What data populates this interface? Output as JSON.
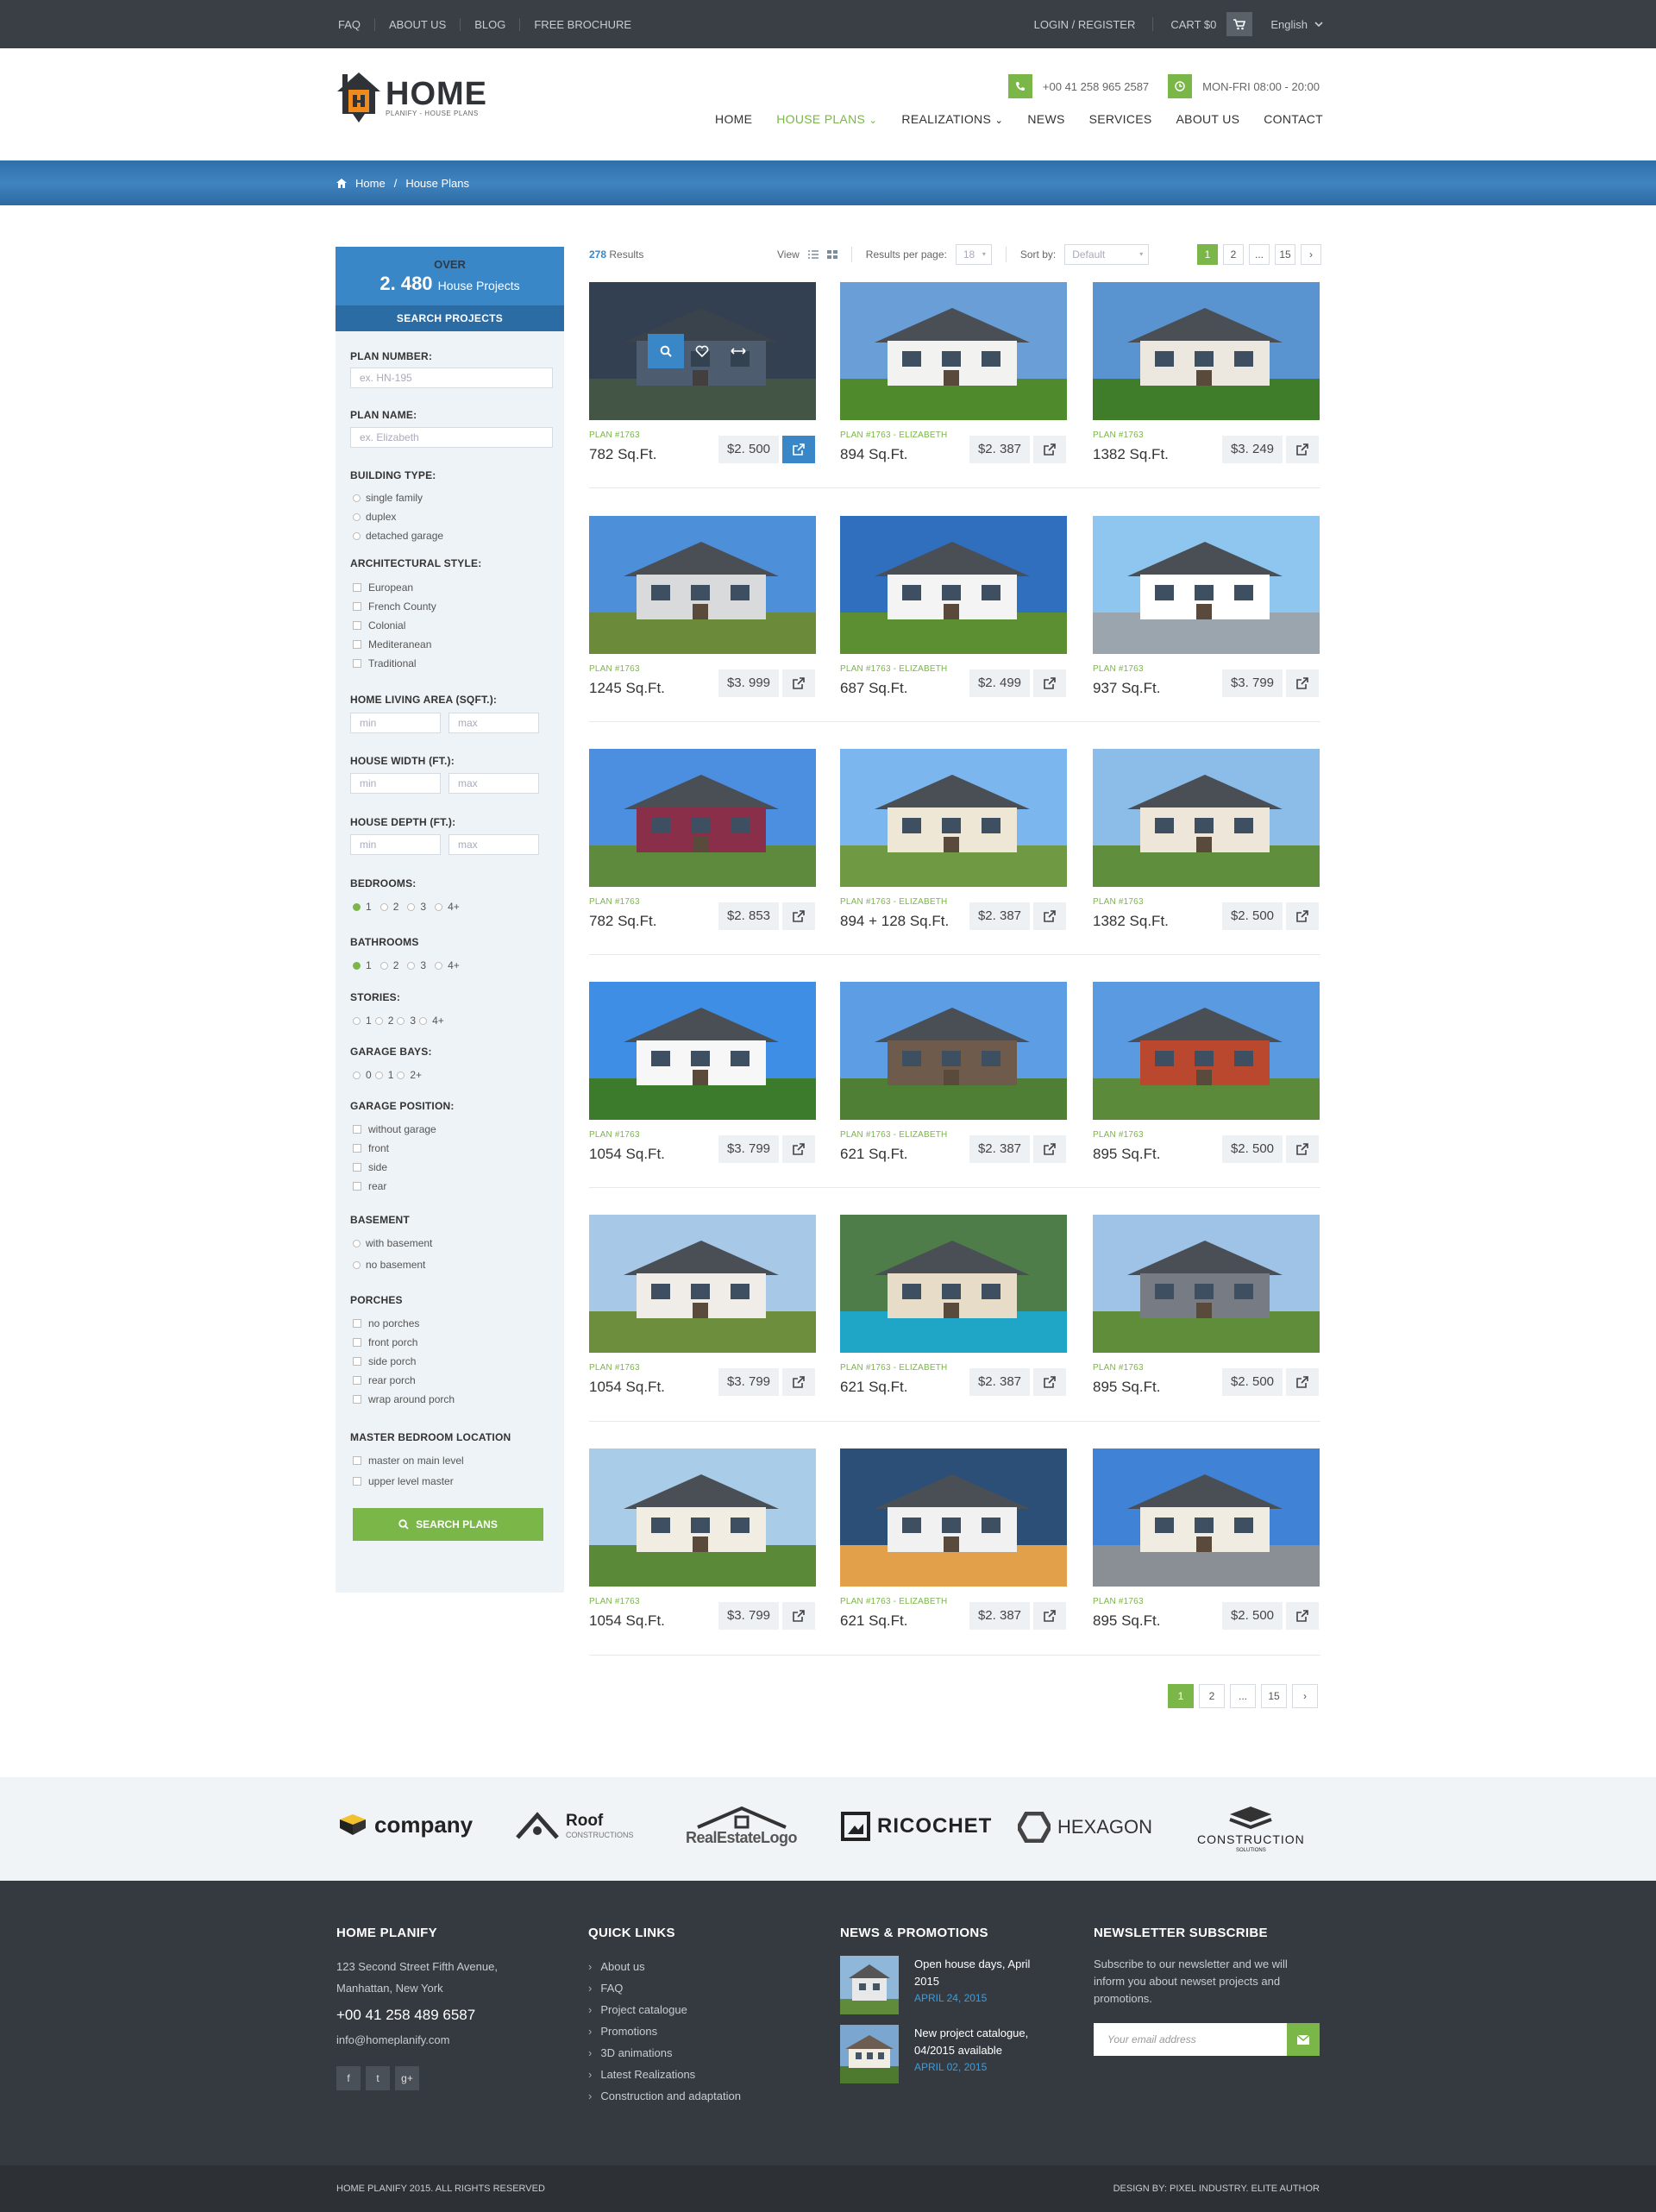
{
  "topbar": {
    "links": [
      "FAQ",
      "ABOUT US",
      "BLOG",
      "FREE BROCHURE"
    ],
    "login": "LOGIN / REGISTER",
    "cart": "CART $0",
    "language": "English"
  },
  "header": {
    "logo_title": "HOME",
    "logo_sub": "PLANIFY - HOUSE PLANS",
    "phone": "+00 41 258 965 2587",
    "hours": "MON-FRI 08:00 - 20:00",
    "nav": [
      "HOME",
      "HOUSE PLANS",
      "REALIZATIONS",
      "NEWS",
      "SERVICES",
      "ABOUT US",
      "CONTACT"
    ]
  },
  "breadcrumb": {
    "home": "Home",
    "sep": "/",
    "current": "House Plans"
  },
  "sidebar": {
    "over": "OVER",
    "count": "2. 480",
    "count_label": "House Projects",
    "search_projects": "SEARCH PROJECTS",
    "plan_number_label": "PLAN NUMBER:",
    "plan_number_ph": "ex. HN-195",
    "plan_name_label": "PLAN NAME:",
    "plan_name_ph": "ex. Elizabeth",
    "building_type_label": "BUILDING TYPE:",
    "building_types": [
      "single family",
      "duplex",
      "detached garage"
    ],
    "arch_style_label": "ARCHITECTURAL STYLE:",
    "arch_styles": [
      "European",
      "French County",
      "Colonial",
      "Mediteranean",
      "Traditional"
    ],
    "living_area_label": "HOME LIVING AREA (SQFT.):",
    "width_label": "HOUSE WIDTH (FT.):",
    "depth_label": "HOUSE DEPTH (FT.):",
    "min": "min",
    "max": "max",
    "bedrooms_label": "BEDROOMS:",
    "bathrooms_label": "BATHROOMS",
    "rooms": [
      "1",
      "2",
      "3",
      "4+"
    ],
    "stories_label": "STORIES:",
    "garage_bays_label": "GARAGE BAYS:",
    "garage_bays": [
      "0",
      "1",
      "2+"
    ],
    "garage_pos_label": "GARAGE POSITION:",
    "garage_pos": [
      "without garage",
      "front",
      "side",
      "rear"
    ],
    "basement_label": "BASEMENT",
    "basement": [
      "with basement",
      "no basement"
    ],
    "porches_label": "PORCHES",
    "porches": [
      "no porches",
      "front porch",
      "side porch",
      "rear porch",
      "wrap around porch"
    ],
    "master_label": "MASTER BEDROOM LOCATION",
    "master": [
      "master on main level",
      "upper level master"
    ],
    "search_plans": "SEARCH PLANS"
  },
  "results": {
    "count": "278",
    "count_label": "Results",
    "view": "View",
    "per_page_label": "Results per page:",
    "per_page": "18",
    "sort_label": "Sort by:",
    "sort": "Default",
    "pages": [
      "1",
      "2",
      "...",
      "15",
      "›"
    ]
  },
  "cards": [
    {
      "plan": "PLAN #1763",
      "sqft": "782 Sq.Ft.",
      "price": "$2. 500"
    },
    {
      "plan": "PLAN #1763 - ELIZABETH",
      "sqft": "894 Sq.Ft.",
      "price": "$2. 387"
    },
    {
      "plan": "PLAN #1763",
      "sqft": "1382 Sq.Ft.",
      "price": "$3. 249"
    },
    {
      "plan": "PLAN #1763",
      "sqft": "1245 Sq.Ft.",
      "price": "$3. 999"
    },
    {
      "plan": "PLAN #1763 - ELIZABETH",
      "sqft": "687 Sq.Ft.",
      "price": "$2. 499"
    },
    {
      "plan": "PLAN #1763",
      "sqft": "937 Sq.Ft.",
      "price": "$3. 799"
    },
    {
      "plan": "PLAN #1763",
      "sqft": "782 Sq.Ft.",
      "price": "$2. 853"
    },
    {
      "plan": "PLAN #1763 - ELIZABETH",
      "sqft": "894 + 128 Sq.Ft.",
      "price": "$2. 387"
    },
    {
      "plan": "PLAN #1763",
      "sqft": "1382 Sq.Ft.",
      "price": "$2. 500"
    },
    {
      "plan": "PLAN #1763",
      "sqft": "1054 Sq.Ft.",
      "price": "$3. 799"
    },
    {
      "plan": "PLAN #1763 - ELIZABETH",
      "sqft": "621 Sq.Ft.",
      "price": "$2. 387"
    },
    {
      "plan": "PLAN #1763",
      "sqft": "895 Sq.Ft.",
      "price": "$2. 500"
    },
    {
      "plan": "PLAN #1763",
      "sqft": "1054 Sq.Ft.",
      "price": "$3. 799"
    },
    {
      "plan": "PLAN #1763 - ELIZABETH",
      "sqft": "621 Sq.Ft.",
      "price": "$2. 387"
    },
    {
      "plan": "PLAN #1763",
      "sqft": "895 Sq.Ft.",
      "price": "$2. 500"
    },
    {
      "plan": "PLAN #1763",
      "sqft": "1054 Sq.Ft.",
      "price": "$3. 799"
    },
    {
      "plan": "PLAN #1763 - ELIZABETH",
      "sqft": "621 Sq.Ft.",
      "price": "$2. 387"
    },
    {
      "plan": "PLAN #1763",
      "sqft": "895 Sq.Ft.",
      "price": "$2. 500"
    }
  ],
  "partners": [
    "company",
    "Roof",
    "CONSTRUCTIONS",
    "RealEstateLogo",
    "RICOCHET",
    "HEXAGON",
    "CONSTRUCTION",
    "SOLUTIONS"
  ],
  "footer": {
    "about_title": "HOME PLANIFY",
    "address1": "123 Second Street Fifth Avenue,",
    "address2": "Manhattan, New York",
    "phone": "+00 41 258 489 6587",
    "email": "info@homeplanify.com",
    "social": [
      "f",
      "t",
      "g+"
    ],
    "links_title": "QUICK LINKS",
    "links": [
      "About us",
      "FAQ",
      "Project catalogue",
      "Promotions",
      "3D animations",
      "Latest Realizations",
      "Construction and adaptation"
    ],
    "news_title": "NEWS & PROMOTIONS",
    "news": [
      {
        "title": "Open house days, April 2015",
        "date": "APRIL 24, 2015"
      },
      {
        "title": "New project catalogue, 04/2015 available",
        "date": "APRIL 02, 2015"
      }
    ],
    "newsletter_title": "NEWSLETTER SUBSCRIBE",
    "newsletter_text": "Subscribe to our newsletter and we will inform you about newset projects and promotions.",
    "email_ph": "Your email address"
  },
  "copyright": "HOME PLANIFY 2015. ALL RIGHTS RESERVED",
  "design_by": "DESIGN BY: PIXEL INDUSTRY. ELITE AUTHOR",
  "colors": {
    "accent": "#7ab648",
    "blue": "#3a87c8",
    "dark": "#353a40"
  }
}
